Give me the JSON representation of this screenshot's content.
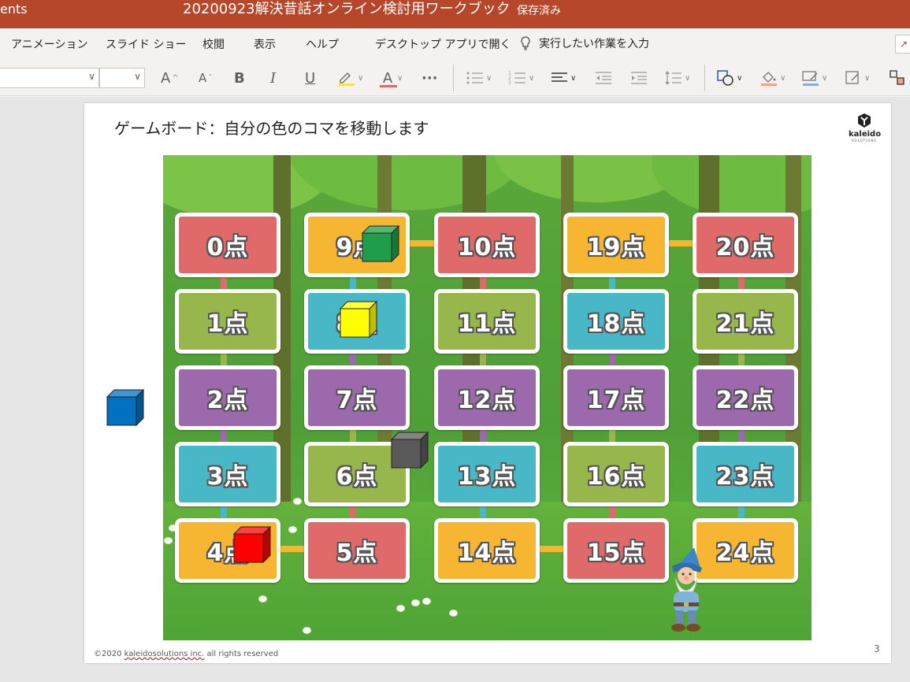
{
  "titlebar": {
    "left_fragment": "ents",
    "document_name": "20200923解決昔話オンライン検討用ワークブック",
    "separator": "-",
    "save_status": "保存済み",
    "color": "#b7472a"
  },
  "menu": {
    "items": [
      "アニメーション",
      "スライド ショー",
      "校閲",
      "表示",
      "ヘルプ",
      "デスクトップ アプリで開く"
    ],
    "tell_me": "実行したい作業を入力"
  },
  "toolbar": {
    "font_grow": "A",
    "font_shrink": "A",
    "bold": "B",
    "italic": "I",
    "underline": "U",
    "font_color": "A",
    "more": "···"
  },
  "slide": {
    "title": "ゲームボード：自分の色のコマを移動します",
    "logo_name": "kaleido",
    "logo_sub": "SOLUTIONS",
    "copyright_prefix": "©2020 ",
    "copyright_link": "kaleidosolutions inc.",
    "copyright_suffix": " all rights reserved",
    "page_number": "3"
  },
  "board": {
    "tiles": [
      {
        "label": "0点",
        "color": "#e06a6a"
      },
      {
        "label": "1点",
        "color": "#97b64b"
      },
      {
        "label": "2点",
        "color": "#9c69ad"
      },
      {
        "label": "3点",
        "color": "#48b8c6"
      },
      {
        "label": "4点",
        "color": "#f6b631"
      },
      {
        "label": "5点",
        "color": "#e06a6a"
      },
      {
        "label": "6点",
        "color": "#97b64b"
      },
      {
        "label": "7点",
        "color": "#9c69ad"
      },
      {
        "label": "8点",
        "color": "#48b8c6"
      },
      {
        "label": "9点",
        "color": "#f6b631"
      },
      {
        "label": "10点",
        "color": "#e06a6a"
      },
      {
        "label": "11点",
        "color": "#97b64b"
      },
      {
        "label": "12点",
        "color": "#9c69ad"
      },
      {
        "label": "13点",
        "color": "#48b8c6"
      },
      {
        "label": "14点",
        "color": "#f6b631"
      },
      {
        "label": "15点",
        "color": "#e06a6a"
      },
      {
        "label": "16点",
        "color": "#97b64b"
      },
      {
        "label": "17点",
        "color": "#9c69ad"
      },
      {
        "label": "18点",
        "color": "#48b8c6"
      },
      {
        "label": "19点",
        "color": "#f6b631"
      },
      {
        "label": "20点",
        "color": "#e06a6a"
      },
      {
        "label": "21点",
        "color": "#97b64b"
      },
      {
        "label": "22点",
        "color": "#9c69ad"
      },
      {
        "label": "23点",
        "color": "#48b8c6"
      },
      {
        "label": "24点",
        "color": "#f6b631"
      }
    ],
    "pieces": [
      {
        "name": "green-piece",
        "color": "#1e9e4a"
      },
      {
        "name": "yellow-piece",
        "color": "#ffff00"
      },
      {
        "name": "gray-piece",
        "color": "#595959"
      },
      {
        "name": "red-piece",
        "color": "#ff0000"
      },
      {
        "name": "blue-piece",
        "color": "#0070c0"
      }
    ]
  }
}
